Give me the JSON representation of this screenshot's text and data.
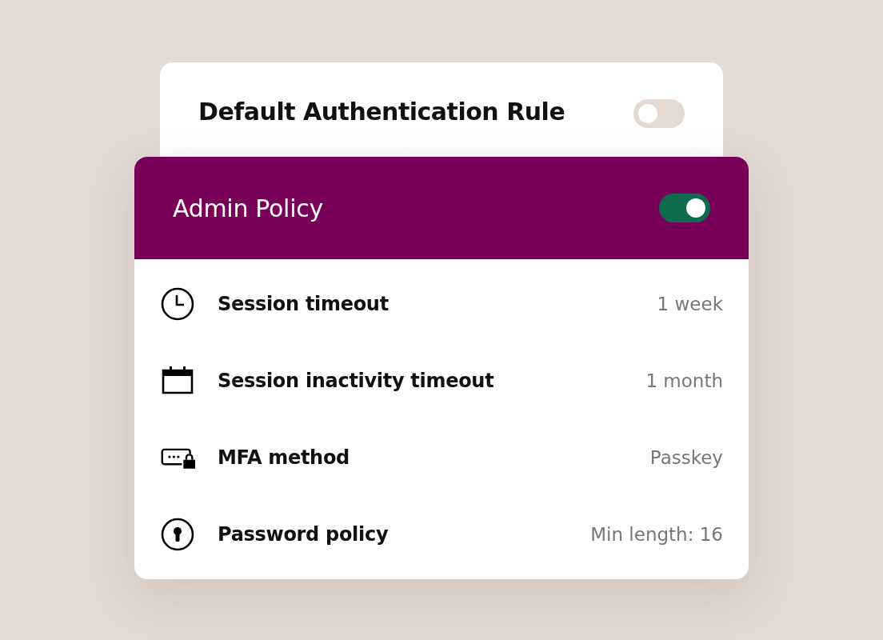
{
  "back_rule": {
    "title": "Default Authentication Rule",
    "on": false
  },
  "policy": {
    "title": "Admin Policy",
    "on": true,
    "settings": [
      {
        "kind": "clock",
        "label": "Session timeout",
        "value": "1 week"
      },
      {
        "kind": "calendar",
        "label": "Session inactivity timeout",
        "value": "1 month"
      },
      {
        "kind": "passkey",
        "label": "MFA method",
        "value": "Passkey"
      },
      {
        "kind": "keyhole",
        "label": "Password policy",
        "value": "Min length: 16"
      }
    ]
  }
}
